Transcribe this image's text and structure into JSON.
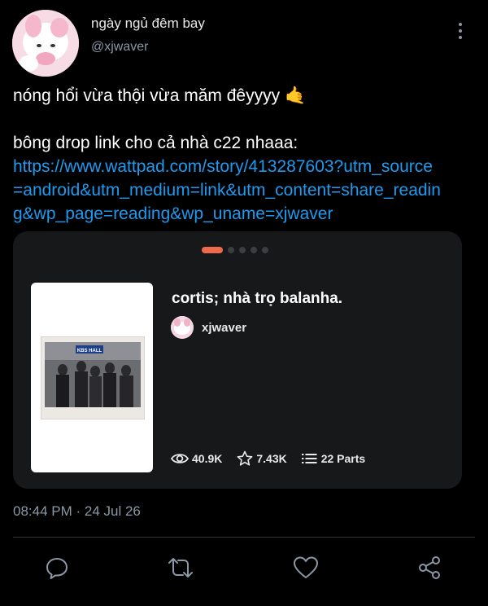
{
  "user": {
    "display_name": "ngày ngủ đêm bay",
    "handle": "@xjwaver"
  },
  "tweet": {
    "line1": "nóng hổi vừa thội vừa măm đêyyyy 🤙",
    "line2": "bông drop link cho cả nhà c22 nhaaa:",
    "link_lines": [
      "https://www.wattpad.com/story/413287603?utm_source",
      "=android&utm_medium=link&utm_content=share_readin",
      "g&wp_page=reading&wp_uname=xjwaver"
    ]
  },
  "card": {
    "carousel_total": 5,
    "carousel_active": 1,
    "story_title": "cortis; nhà trọ balanha.",
    "author": "xjwaver",
    "stats": {
      "reads": "40.9K",
      "votes": "7.43K",
      "parts": "22 Parts"
    },
    "photo_sign": "KBS HALL"
  },
  "timestamp": "08:44 PM · 24 Jul 26",
  "icons": [
    "more-vertical-icon",
    "eye-icon",
    "star-icon",
    "list-icon",
    "reply-icon",
    "retweet-icon",
    "like-icon",
    "share-icon"
  ],
  "colors": {
    "link": "#1d9bf0",
    "carousel_active": "#ee6a4c",
    "muted": "#8b98a5"
  }
}
